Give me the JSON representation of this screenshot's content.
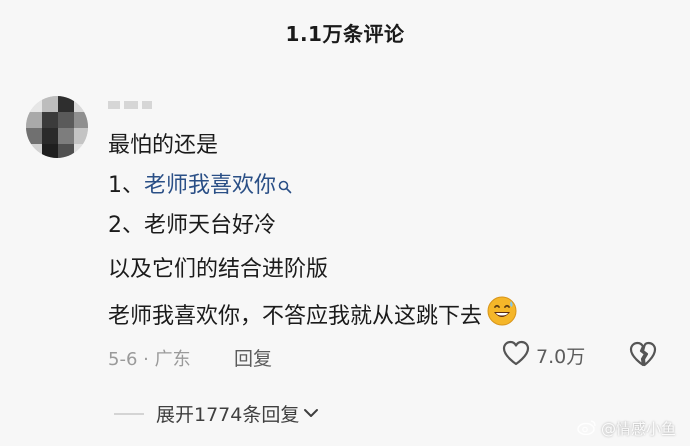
{
  "header": {
    "title": "1.1万条评论"
  },
  "comment": {
    "lines": {
      "intro": "最怕的还是",
      "item1_prefix": "1、",
      "item1_link": "老师我喜欢你",
      "item2": "2、老师天台好冷",
      "combo": "以及它们的结合进阶版",
      "final": "老师我喜欢你，不答应我就从这跳下去"
    },
    "meta": "5-6 · 广东",
    "reply_label": "回复",
    "likes": "7.0万"
  },
  "replies": {
    "expand_label": "展开1774条回复"
  },
  "watermark": {
    "text": "@情感小鱼"
  },
  "icons": {
    "search": "search-icon",
    "heart": "heart-icon",
    "broken_heart": "broken-heart-icon",
    "chevron": "chevron-down-icon",
    "emoji": "grinning-sweat-emoji-icon",
    "weibo": "weibo-logo-icon"
  },
  "colors": {
    "link": "#2a4f86",
    "meta": "#9a9a9a",
    "text": "#1b1b1b",
    "background": "#f7f7f7",
    "emoji_face": "#f5b629"
  }
}
